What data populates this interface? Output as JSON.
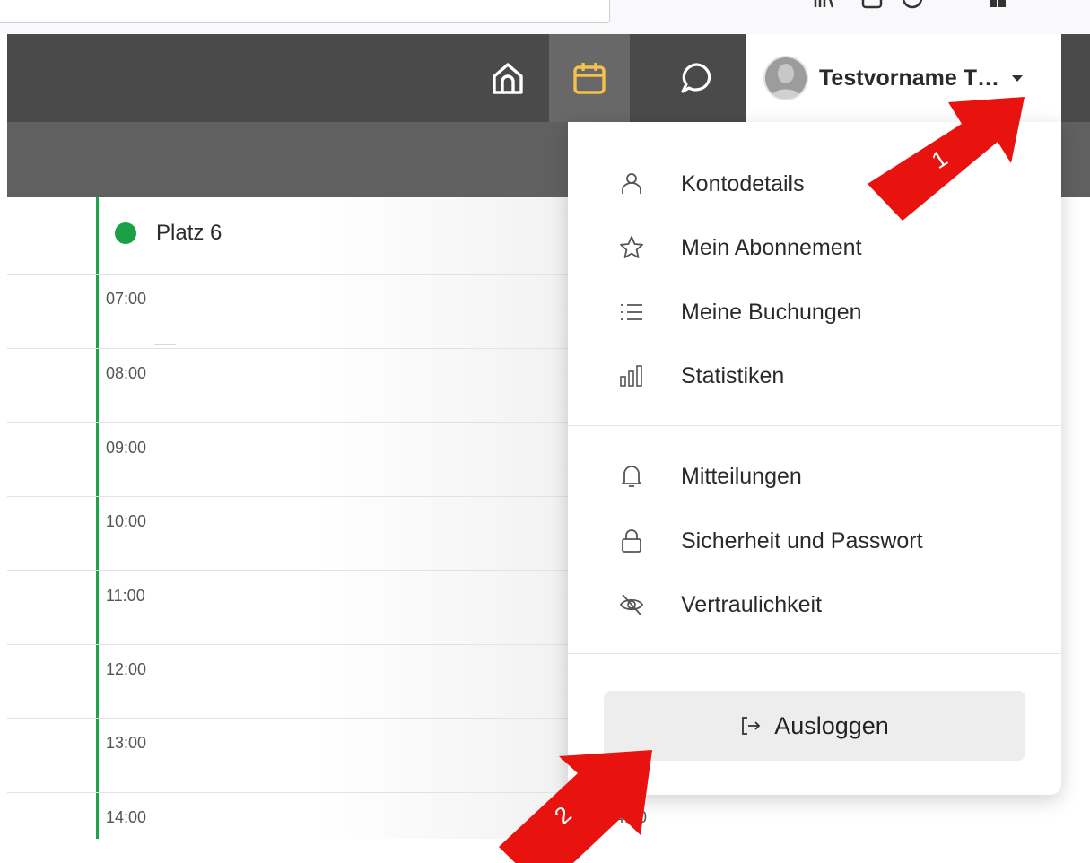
{
  "nav": {
    "home_icon": "home-icon",
    "calendar_icon": "calendar-icon",
    "chat_icon": "chat-icon",
    "user_name": "Testvorname T…",
    "active_color": "#f2c14e"
  },
  "calendar": {
    "court": "Platz 6",
    "court_color": "#1aa045",
    "times": [
      "07:00",
      "08:00",
      "09:00",
      "10:00",
      "11:00",
      "12:00",
      "13:00",
      "14:00"
    ],
    "second_column_time": "14:30"
  },
  "menu": {
    "items": [
      {
        "label": "Kontodetails",
        "icon": "user-icon"
      },
      {
        "label": "Mein Abonnement",
        "icon": "star-icon"
      },
      {
        "label": "Meine Buchungen",
        "icon": "list-icon"
      },
      {
        "label": "Statistiken",
        "icon": "bar-chart-icon"
      },
      {
        "label": "Mitteilungen",
        "icon": "bell-icon"
      },
      {
        "label": "Sicherheit und Passwort",
        "icon": "lock-icon"
      },
      {
        "label": "Vertraulichkeit",
        "icon": "eye-off-icon"
      }
    ],
    "logout": "Ausloggen"
  },
  "annotations": {
    "arrow1": "1",
    "arrow2": "2",
    "arrow_color": "#e8120f"
  }
}
